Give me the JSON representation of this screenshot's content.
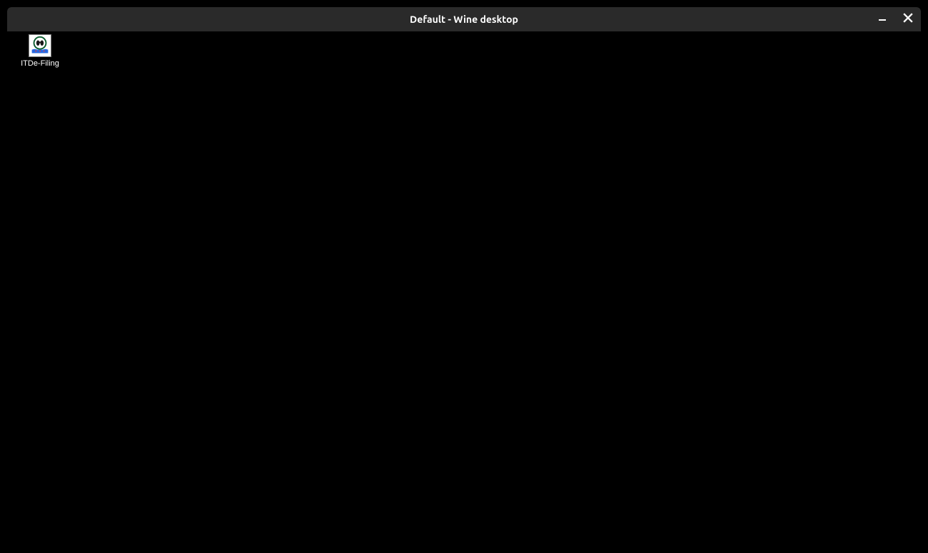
{
  "window": {
    "title": "Default - Wine desktop"
  },
  "desktop": {
    "icons": [
      {
        "label": "ITDe-Filing",
        "icon_name": "itde-filing-app-icon"
      }
    ]
  }
}
